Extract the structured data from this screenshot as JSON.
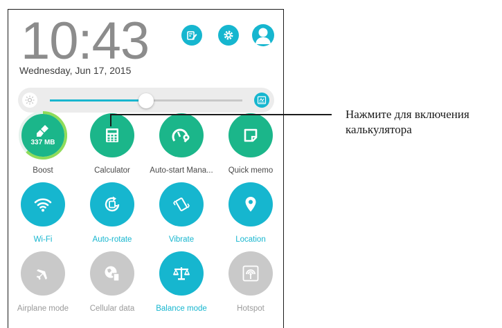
{
  "status": {
    "time": "10:43",
    "date": "Wednesday, Jun 17, 2015"
  },
  "header_icons": [
    "edit-icon",
    "gear-icon",
    "user-avatar-icon"
  ],
  "brightness": {
    "level_percent": 50,
    "start_icon": "auto-brightness-icon",
    "end_icon": "auto-icon"
  },
  "tiles": [
    {
      "name": "boost",
      "label": "Boost",
      "badge": "337 MB",
      "color": "#1bb68a",
      "icon": "broom-icon"
    },
    {
      "name": "calculator",
      "label": "Calculator",
      "color": "#1bb68a",
      "icon": "calculator-icon"
    },
    {
      "name": "auto-start",
      "label": "Auto-start Mana...",
      "color": "#1bb68a",
      "icon": "gauge-wrench-icon"
    },
    {
      "name": "quick-memo",
      "label": "Quick memo",
      "color": "#1bb68a",
      "icon": "memo-icon"
    },
    {
      "name": "wifi",
      "label": "Wi-Fi",
      "color": "#16b6cf",
      "icon": "wifi-icon"
    },
    {
      "name": "auto-rotate",
      "label": "Auto-rotate",
      "color": "#16b6cf",
      "icon": "rotate-icon"
    },
    {
      "name": "vibrate",
      "label": "Vibrate",
      "color": "#16b6cf",
      "icon": "vibrate-icon"
    },
    {
      "name": "location",
      "label": "Location",
      "color": "#16b6cf",
      "icon": "location-pin-icon"
    },
    {
      "name": "airplane",
      "label": "Airplane mode",
      "color": "#c9c9c9",
      "icon": "airplane-icon"
    },
    {
      "name": "cellular",
      "label": "Cellular data",
      "color": "#c9c9c9",
      "icon": "globe-phone-icon"
    },
    {
      "name": "balance",
      "label": "Balance mode",
      "color": "#16b6cf",
      "icon": "balance-scale-icon"
    },
    {
      "name": "hotspot",
      "label": "Hotspot",
      "color": "#c9c9c9",
      "icon": "hotspot-icon"
    }
  ],
  "callout": {
    "line1": "Нажмите для включения",
    "line2": "калькулятора"
  }
}
